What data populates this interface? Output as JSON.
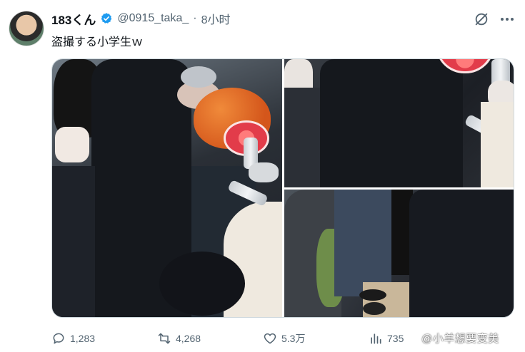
{
  "tweet": {
    "display_name": "183くん",
    "handle": "@0915_taka_",
    "separator": "·",
    "time": "8小时",
    "text": "盗撮する小学生ｗ"
  },
  "icons": {
    "verified": "verified-badge-icon",
    "grok": "grok-icon",
    "more": "more-icon",
    "reply": "reply-icon",
    "retweet": "retweet-icon",
    "like": "like-icon",
    "views": "views-icon"
  },
  "colors": {
    "verified_blue": "#1d9bf0",
    "text_primary": "#0f1419",
    "text_secondary": "#536471",
    "border": "#cfd9de"
  },
  "actions": {
    "replies": "1,283",
    "retweets": "4,268",
    "likes": "5.3万",
    "views": "735"
  },
  "watermark": "@小羊想要变美"
}
